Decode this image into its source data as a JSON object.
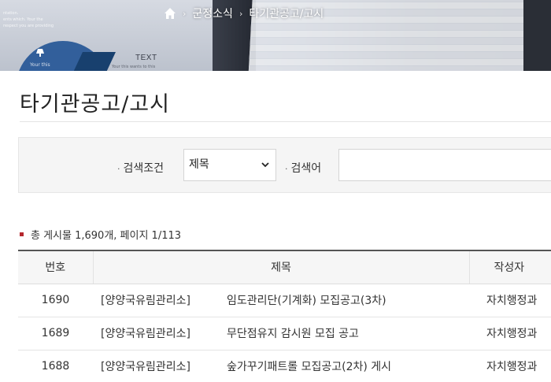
{
  "hero": {
    "tiny_texts": [
      "ntation.",
      "ents which. Your the",
      "respect you are providing"
    ],
    "fan_caption": "Your this",
    "sub_caption": "Your this wants to this",
    "text_label": "TEXT"
  },
  "breadcrumb": {
    "items": [
      "군정소식",
      "타기관공고/고시"
    ]
  },
  "page": {
    "title": "타기관공고/고시"
  },
  "search": {
    "condition_label": "검색조건",
    "condition_value": "제목",
    "keyword_label": "검색어",
    "keyword_value": ""
  },
  "summary": {
    "text": "총 게시물 1,690개, 페이지 1/113"
  },
  "table": {
    "headers": {
      "num": "번호",
      "title": "제목",
      "author": "작성자"
    },
    "rows": [
      {
        "num": "1690",
        "category": "[양양국유림관리소]",
        "subject": "임도관리단(기계화) 모집공고(3차)",
        "author": "자치행정과"
      },
      {
        "num": "1689",
        "category": "[양양국유림관리소]",
        "subject": "무단점유지 감시원 모집 공고",
        "author": "자치행정과"
      },
      {
        "num": "1688",
        "category": "[양양국유림관리소]",
        "subject": "숲가꾸기패트롤 모집공고(2차) 게시",
        "author": "자치행정과"
      }
    ]
  },
  "colors": {
    "accent": "#b5272d",
    "header_rule": "#555555"
  }
}
